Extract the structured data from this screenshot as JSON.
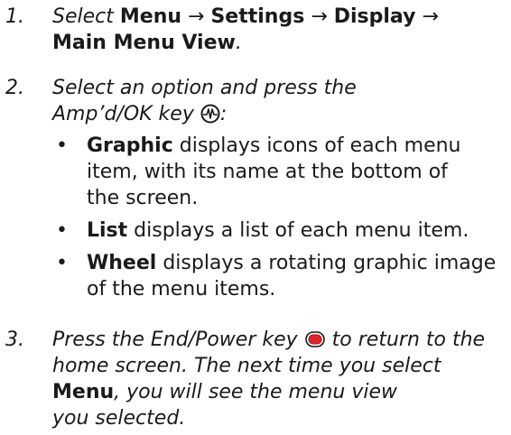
{
  "steps": [
    {
      "number": "1.",
      "select_word": "Select",
      "menu": "Menu",
      "arrow": "→",
      "settings": "Settings",
      "display": "Display",
      "main_menu_view": "Main Menu View",
      "period": "."
    },
    {
      "number": "2.",
      "line1": "Select an option and press the",
      "line2_text": "Amp’d/OK key",
      "line2_colon": ":",
      "ok_icon": "amp-ok-key-icon",
      "bullets": [
        {
          "bullet": "•",
          "term": "Graphic",
          "lines": [
            "displays icons of each menu",
            "item, with its name at the bottom of",
            "the screen."
          ]
        },
        {
          "bullet": "•",
          "term": "List",
          "lines": [
            "displays a list of each menu item."
          ]
        },
        {
          "bullet": "•",
          "term": "Wheel",
          "lines": [
            "displays a rotating graphic image",
            "of the menu items."
          ]
        }
      ]
    },
    {
      "number": "3.",
      "line1_before": "Press the End/Power key",
      "line1_after": "to return to the",
      "end_icon": "end-power-key-icon",
      "line2": "home screen. The next time you select",
      "line3_bold": "Menu",
      "line3_rest": ", you will see the menu view",
      "line4": "you selected."
    }
  ]
}
